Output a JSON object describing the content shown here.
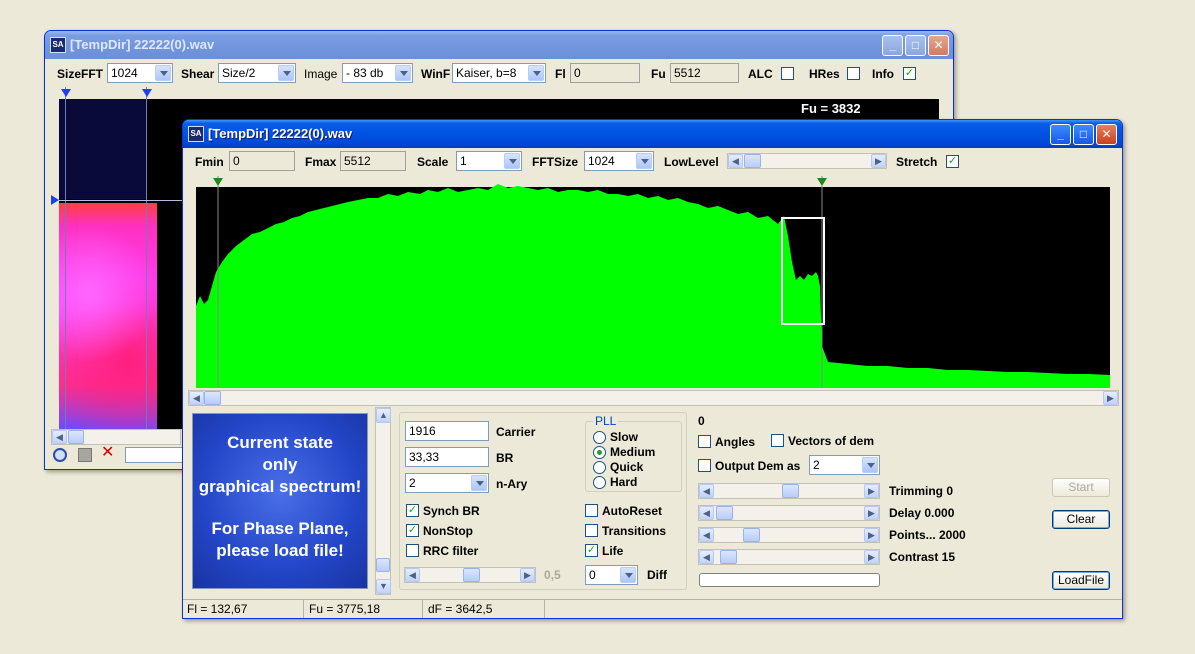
{
  "back_window": {
    "title": "[TempDir] 22222(0).wav",
    "toolbar": {
      "sizefft_label": "SizeFFT",
      "sizefft_value": "1024",
      "shear_label": "Shear",
      "shear_value": "Size/2",
      "image_label": "Image",
      "image_value": "- 83 db",
      "winf_label": "WinF",
      "winf_value": "Kaiser, b=8",
      "fl_label": "Fl",
      "fl_value": "0",
      "fu_label": "Fu",
      "fu_value": "5512",
      "alc_label": "ALC",
      "alc_checked": false,
      "hres_label": "HRes",
      "hres_checked": false,
      "info_label": "Info",
      "info_checked": true
    },
    "overlay_text": "Fu = 3832",
    "icons": [
      "zoom-icon",
      "save-icon",
      "close-red-icon"
    ]
  },
  "front_window": {
    "title": "[TempDir] 22222(0).wav",
    "toolbar": {
      "fmin_label": "Fmin",
      "fmin_value": "0",
      "fmax_label": "Fmax",
      "fmax_value": "5512",
      "scale_label": "Scale",
      "scale_value": "1",
      "fftsize_label": "FFTSize",
      "fftsize_value": "1024",
      "lowlevel_label": "LowLevel",
      "stretch_label": "Stretch",
      "stretch_checked": true
    },
    "spectrum": {
      "fill_color": "#00ff00",
      "background": "#000000"
    },
    "info_panel": {
      "line1": "Current state",
      "line2": "only",
      "line3": "graphical spectrum!",
      "line4": "For Phase Plane,",
      "line5": "please load file!"
    },
    "controls": {
      "carrier_value": "1916",
      "carrier_label": "Carrier",
      "br_value": "33,33",
      "br_label": "BR",
      "nary_value": "2",
      "nary_label": "n-Ary",
      "pll_title": "PLL",
      "pll_options": [
        "Slow",
        "Medium",
        "Quick",
        "Hard"
      ],
      "pll_selected": "Medium",
      "synch_br_label": "Synch BR",
      "synch_br_checked": true,
      "nonstop_label": "NonStop",
      "nonstop_checked": true,
      "rrc_label": "RRC filter",
      "rrc_checked": false,
      "autoreset_label": "AutoReset",
      "autoreset_checked": false,
      "transitions_label": "Transitions",
      "transitions_checked": false,
      "life_label": "Life",
      "life_checked": true,
      "rolloff_value": "0,5",
      "diff_value": "0",
      "diff_label": "Diff"
    },
    "right_panel": {
      "zero_text": "0",
      "angles_label": "Angles",
      "angles_checked": false,
      "vectors_label": "Vectors of dem",
      "vectors_checked": false,
      "output_label": "Output Dem as",
      "output_checked": false,
      "output_value": "2",
      "trimming_label": "Trimming 0",
      "delay_label": "Delay  0.000",
      "points_label": "Points... 2000",
      "contrast_label": "Contrast 15"
    },
    "buttons": {
      "start": "Start",
      "clear": "Clear",
      "loadfile": "LoadFile"
    },
    "status": {
      "fl": "Fl = 132,67",
      "fu": "Fu = 3775,18",
      "df": "dF = 3642,5"
    }
  }
}
